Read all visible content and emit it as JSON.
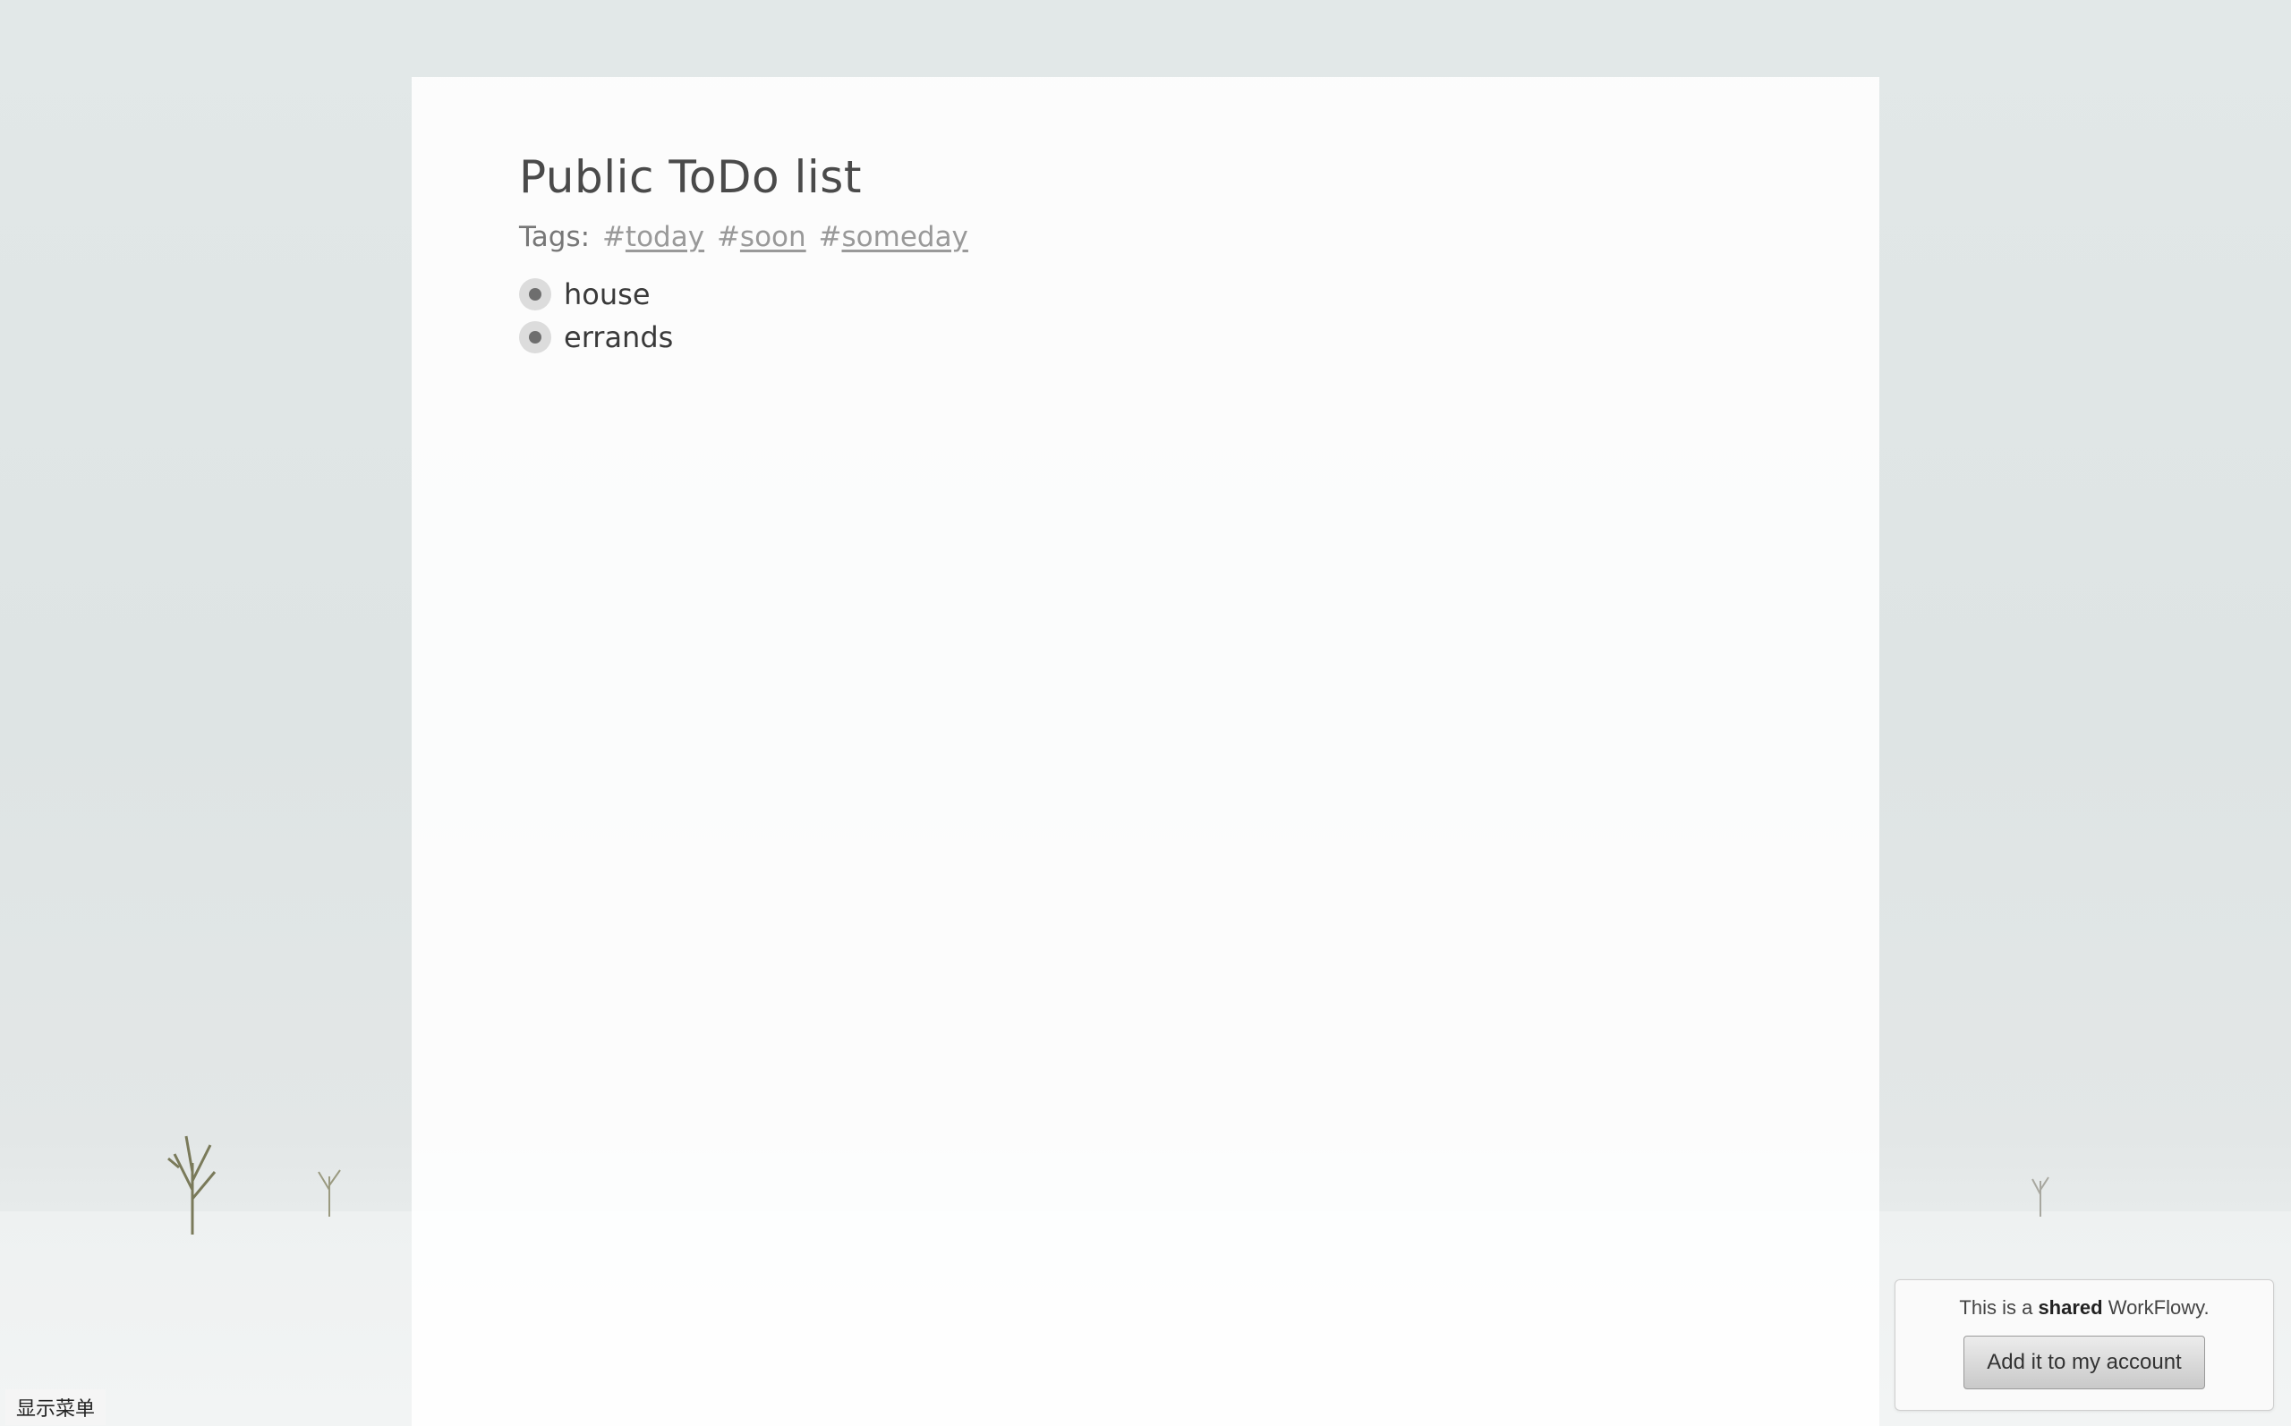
{
  "document": {
    "title": "Public ToDo list",
    "tags_label": "Tags:",
    "tags": [
      {
        "hash": "#",
        "name": "today"
      },
      {
        "hash": "#",
        "name": "soon"
      },
      {
        "hash": "#",
        "name": "someday"
      }
    ],
    "items": [
      {
        "text": "house"
      },
      {
        "text": "errands"
      }
    ]
  },
  "shared_notice": {
    "prefix": "This is a ",
    "emphasis": "shared",
    "suffix": " WorkFlowy.",
    "button_label": "Add it to my account"
  },
  "menu": {
    "show_menu_label": "显示菜单"
  }
}
